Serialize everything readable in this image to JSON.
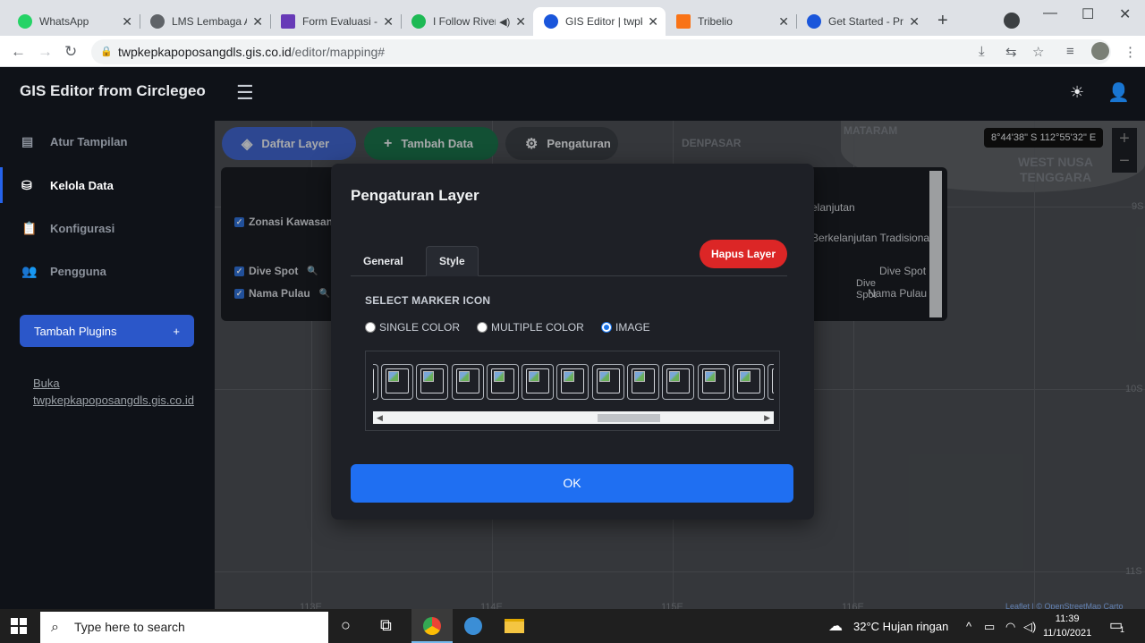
{
  "browser": {
    "tabs": [
      {
        "title": "WhatsApp",
        "color": "#25d366"
      },
      {
        "title": "LMS Lembaga Ad",
        "color": "#5f6368"
      },
      {
        "title": "Form Evaluasi - G",
        "color": "#673ab7"
      },
      {
        "title": "I Follow River",
        "color": "#1db954"
      },
      {
        "title": "GIS Editor | twpke",
        "color": "#1a56db"
      },
      {
        "title": "Tribelio",
        "color": "#f97316"
      },
      {
        "title": "Get Started - Pro",
        "color": "#1a56db"
      }
    ],
    "url_host": "twpkepkapoposangdls.gis.co.id",
    "url_path": "/editor/mapping#"
  },
  "app": {
    "brand": "GIS Editor from Circlegeo",
    "sidebar": {
      "items": [
        {
          "label": "Atur Tampilan",
          "icon": "layout-icon"
        },
        {
          "label": "Kelola Data",
          "icon": "database-icon"
        },
        {
          "label": "Konfigurasi",
          "icon": "clipboard-icon"
        },
        {
          "label": "Pengguna",
          "icon": "users-icon"
        }
      ],
      "plugins_label": "Tambah Plugins",
      "plugins_plus": "+",
      "open_link_line1": "Buka",
      "open_link_line2": "twpkepkapoposangdls.gis.co.id"
    }
  },
  "map": {
    "toolbar": {
      "layers": "Daftar Layer",
      "add_data": "Tambah Data",
      "settings": "Pengaturan"
    },
    "coords": "8°44'38\" S 112°55'32\" E",
    "labels": {
      "denpasar": "DENPASAR",
      "mataram": "MATARAM",
      "wnt1": "WEST NUSA",
      "wnt2": "TENGGARA"
    },
    "ticks": {
      "y1": "9S",
      "y2": "10S",
      "y3": "11S",
      "x1": "113E",
      "x2": "114E",
      "x3": "115E",
      "x4": "116E"
    },
    "attribution": "Leaflet | © OpenStreetMap Carto",
    "layer_panel": {
      "zonasi": "Zonasi Kawasan",
      "dive_spot": "Dive Spot",
      "nama_pulau": "Nama Pulau",
      "right1": "elanjutan",
      "right2": "Berkelanjutan Tradisional",
      "legend_dive": "Dive Spot",
      "legend_dive_alt1": "Dive",
      "legend_dive_alt2": "Spot",
      "legend_pulau": "Nama Pulau"
    }
  },
  "modal": {
    "title": "Pengaturan Layer",
    "tabs": [
      "General",
      "Style"
    ],
    "delete_label": "Hapus Layer",
    "section_label": "SELECT MARKER ICON",
    "radios": [
      "SINGLE COLOR",
      "MULTIPLE COLOR",
      "IMAGE"
    ],
    "selected_radio": "IMAGE",
    "ok_label": "OK"
  },
  "taskbar": {
    "search_placeholder": "Type here to search",
    "weather": "32°C  Hujan ringan",
    "time": "11:39",
    "date": "11/10/2021",
    "notification_count": "1"
  }
}
